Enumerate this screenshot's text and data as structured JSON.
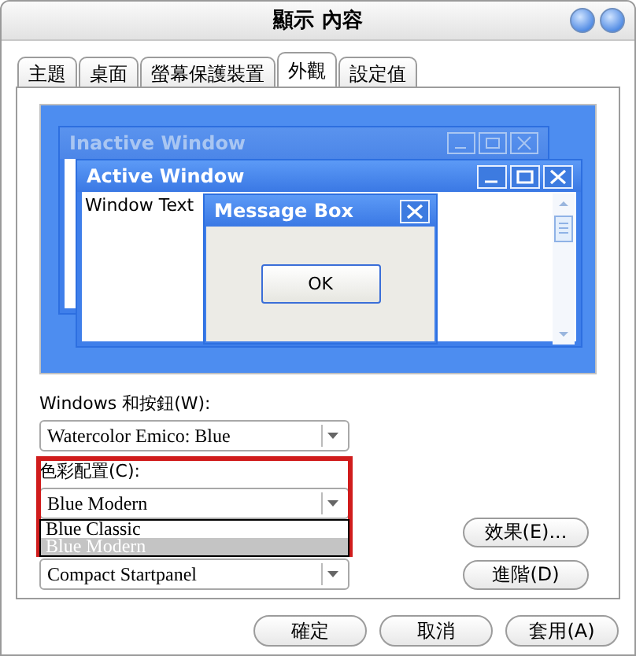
{
  "window": {
    "title": "顯示 內容"
  },
  "tabs": [
    {
      "label": "主題",
      "selected": false
    },
    {
      "label": "桌面",
      "selected": false
    },
    {
      "label": "螢幕保護裝置",
      "selected": false
    },
    {
      "label": "外觀",
      "selected": true
    },
    {
      "label": "設定值",
      "selected": false
    }
  ],
  "preview": {
    "inactive_window": {
      "title": "Inactive Window"
    },
    "active_window": {
      "title": "Active Window",
      "text": "Window Text"
    },
    "message_box": {
      "title": "Message Box",
      "button": "OK"
    }
  },
  "windows_buttons": {
    "label": "Windows 和按鈕(W):",
    "value": "Watercolor Emico: Blue"
  },
  "color_scheme": {
    "label": "色彩配置(C):",
    "value": "Blue Modern",
    "highlighted": true,
    "expanded": true,
    "options": [
      {
        "label": "Blue Classic",
        "selected": false
      },
      {
        "label": "Blue Modern",
        "selected": true
      }
    ]
  },
  "font_size": {
    "value": "Compact Startpanel"
  },
  "side_buttons": [
    "效果(E)...",
    "進階(D)"
  ],
  "buttons": [
    "確定",
    "取消",
    "套用(A)"
  ]
}
